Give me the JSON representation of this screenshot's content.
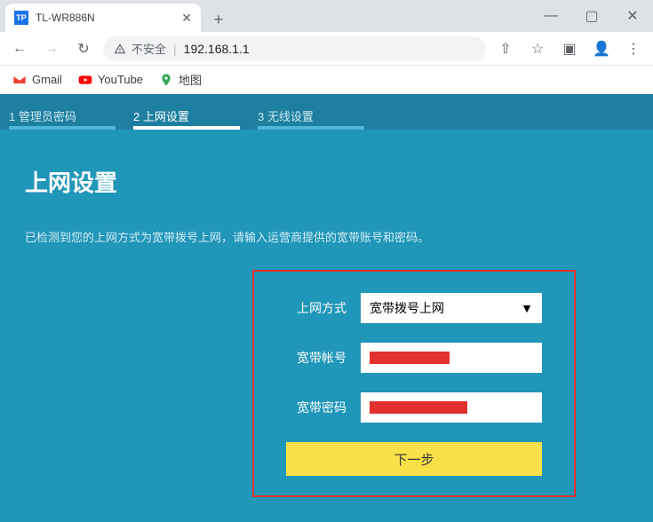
{
  "browser": {
    "tab_title": "TL-WR886N",
    "tab_icon_text": "TP",
    "newtab_glyph": "+",
    "win_min": "—",
    "win_max": "▢",
    "win_close": "✕",
    "back": "←",
    "forward": "→",
    "reload": "↻",
    "insecure_label": "不安全",
    "url": "192.168.1.1",
    "share": "⇧",
    "star": "☆",
    "ext": "▣",
    "profile": "👤",
    "menu": "⋮"
  },
  "bookmarks": {
    "gmail": "Gmail",
    "youtube": "YouTube",
    "maps": "地图"
  },
  "steps": {
    "s1": "1 管理员密码",
    "s2": "2 上网设置",
    "s3": "3 无线设置"
  },
  "page": {
    "title": "上网设置",
    "desc": "已检测到您的上网方式为宽带拨号上网，请输入运营商提供的宽带账号和密码。"
  },
  "form": {
    "method_label": "上网方式",
    "method_value": "宽带拨号上网",
    "user_label": "宽带帐号",
    "pass_label": "宽带密码",
    "next": "下一步"
  }
}
